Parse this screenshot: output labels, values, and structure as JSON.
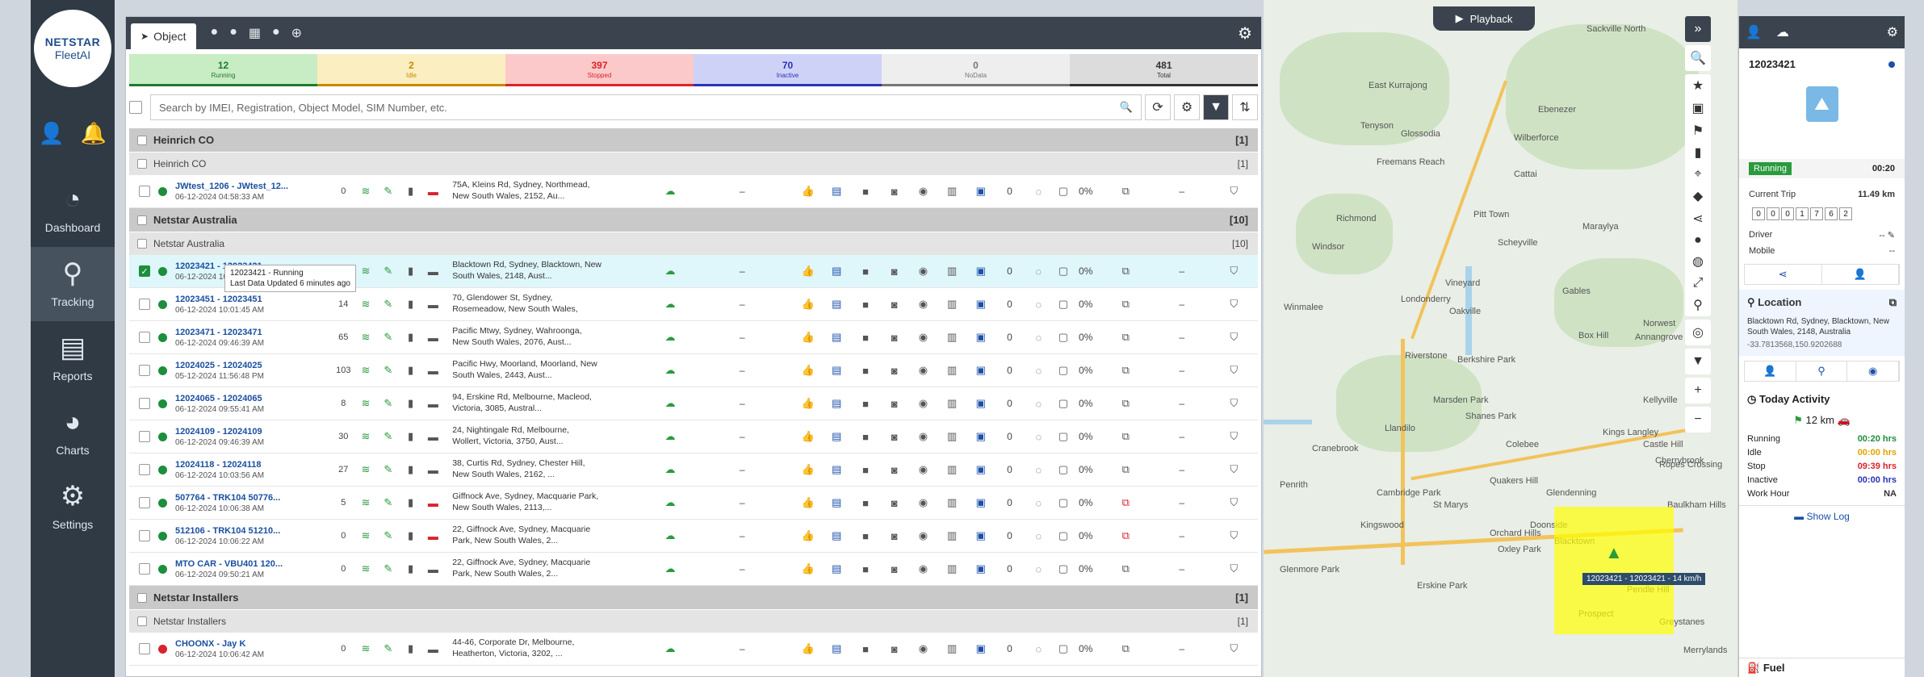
{
  "brand": {
    "line1": "NETSTAR",
    "line2": "FleetAI"
  },
  "nav": {
    "user_icon": "user-icon",
    "bell_icon": "bell-icon",
    "items": [
      {
        "label": "Dashboard",
        "icon": "◔",
        "active": false
      },
      {
        "label": "Tracking",
        "icon": "⚲",
        "active": true
      },
      {
        "label": "Reports",
        "icon": "▤",
        "active": false
      },
      {
        "label": "Charts",
        "icon": "◕",
        "active": false
      },
      {
        "label": "Settings",
        "icon": "⚙",
        "active": false
      }
    ]
  },
  "panel": {
    "tab_label": "Object",
    "status": [
      {
        "count": "12",
        "label": "Running",
        "bg": "#c8ecc4",
        "color": "#1d7a30"
      },
      {
        "count": "2",
        "label": "Idle",
        "bg": "#fbeec0",
        "color": "#c98a00"
      },
      {
        "count": "397",
        "label": "Stopped",
        "bg": "#fbc9c9",
        "color": "#d9232d"
      },
      {
        "count": "70",
        "label": "Inactive",
        "bg": "#cfd2f7",
        "color": "#2832b8"
      },
      {
        "count": "0",
        "label": "NoData",
        "bg": "#eeeeee",
        "color": "#777777"
      },
      {
        "count": "481",
        "label": "Total",
        "bg": "#dcdcdc",
        "color": "#333333"
      }
    ],
    "search_placeholder": "Search by IMEI, Registration, Object Model, SIM Number, etc.",
    "groups": [
      {
        "name": "Heinrich CO",
        "count": "[1]",
        "sub": "Heinrich CO",
        "subcount": "[1]"
      },
      {
        "name": "Netstar Australia",
        "count": "[10]",
        "sub": "Netstar Australia",
        "subcount": "[10]"
      },
      {
        "name": "Netstar Installers",
        "count": "[1]",
        "sub": "Netstar Installers",
        "subcount": "[1]"
      }
    ],
    "rows": [
      {
        "id": "JWtest_1206 - JWtest_12...",
        "ts": "06-12-2024 04:58:33 AM",
        "speed": "0",
        "addr1": "75A, Kleins Rd, Sydney, Northmead,",
        "addr2": "New South Wales, 2152, Au...",
        "dot": "#1d8e3c",
        "dash": "–",
        "zero": "0",
        "pct": "0%",
        "checked": false,
        "sel": false
      },
      {
        "id": "12023421 - 12023421",
        "ts": "06-12-2024 10:02:45 AM",
        "speed": "14",
        "addr1": "Blacktown Rd, Sydney, Blacktown, New",
        "addr2": "South Wales, 2148, Aust...",
        "dot": "#1d8e3c",
        "dash": "–",
        "zero": "0",
        "pct": "0%",
        "checked": true,
        "sel": true
      },
      {
        "id": "12023451 - 12023451",
        "ts": "06-12-2024 10:01:45 AM",
        "speed": "14",
        "addr1": "70, Glendower St, Sydney,",
        "addr2": "Rosemeadow, New South Wales,",
        "dot": "#1d8e3c",
        "dash": "–",
        "zero": "0",
        "pct": "0%",
        "checked": false,
        "sel": false
      },
      {
        "id": "12023471 - 12023471",
        "ts": "06-12-2024 09:46:39 AM",
        "speed": "65",
        "addr1": "Pacific Mtwy, Sydney, Wahroonga,",
        "addr2": "New South Wales, 2076, Aust...",
        "dot": "#1d8e3c",
        "dash": "–",
        "zero": "0",
        "pct": "0%",
        "checked": false,
        "sel": false
      },
      {
        "id": "12024025 - 12024025",
        "ts": "05-12-2024 11:56:48 PM",
        "speed": "103",
        "addr1": "Pacific Hwy, Moorland, Moorland, New",
        "addr2": "South Wales, 2443, Aust...",
        "dot": "#1d8e3c",
        "dash": "–",
        "zero": "0",
        "pct": "0%",
        "checked": false,
        "sel": false
      },
      {
        "id": "12024065 - 12024065",
        "ts": "06-12-2024 09:55:41 AM",
        "speed": "8",
        "addr1": "94, Erskine Rd, Melbourne, Macleod,",
        "addr2": "Victoria, 3085, Austral...",
        "dot": "#1d8e3c",
        "dash": "–",
        "zero": "0",
        "pct": "0%",
        "checked": false,
        "sel": false
      },
      {
        "id": "12024109 - 12024109",
        "ts": "06-12-2024 09:46:39 AM",
        "speed": "30",
        "addr1": "24, Nightingale Rd, Melbourne,",
        "addr2": "Wollert, Victoria, 3750, Aust...",
        "dot": "#1d8e3c",
        "dash": "–",
        "zero": "0",
        "pct": "0%",
        "checked": false,
        "sel": false
      },
      {
        "id": "12024118 - 12024118",
        "ts": "06-12-2024 10:03:56 AM",
        "speed": "27",
        "addr1": "38, Curtis Rd, Sydney, Chester Hill,",
        "addr2": "New South Wales, 2162, ...",
        "dot": "#1d8e3c",
        "dash": "–",
        "zero": "0",
        "pct": "0%",
        "checked": false,
        "sel": false
      },
      {
        "id": "507764 - TRK104 50776...",
        "ts": "06-12-2024 10:06:38 AM",
        "speed": "5",
        "addr1": "Giffnock Ave, Sydney, Macquarie Park,",
        "addr2": "New South Wales, 2113,...",
        "dot": "#1d8e3c",
        "dash": "–",
        "zero": "0",
        "pct": "0%",
        "checked": false,
        "sel": false
      },
      {
        "id": "512106 - TRK104 51210...",
        "ts": "06-12-2024 10:06:22 AM",
        "speed": "0",
        "addr1": "22, Giffnock Ave, Sydney, Macquarie",
        "addr2": "Park, New South Wales, 2...",
        "dot": "#1d8e3c",
        "dash": "–",
        "zero": "0",
        "pct": "0%",
        "checked": false,
        "sel": false
      },
      {
        "id": "MTO CAR - VBU401 120...",
        "ts": "06-12-2024 09:50:21 AM",
        "speed": "0",
        "addr1": "22, Giffnock Ave, Sydney, Macquarie",
        "addr2": "Park, New South Wales, 2...",
        "dot": "#1d8e3c",
        "dash": "–",
        "zero": "0",
        "pct": "0%",
        "checked": false,
        "sel": false
      },
      {
        "id": "CHOONX - Jay K",
        "ts": "06-12-2024 10:06:42 AM",
        "speed": "0",
        "addr1": "44-46, Corporate Dr, Melbourne,",
        "addr2": "Heatherton, Victoria, 3202, ...",
        "dot": "#d9232d",
        "dash": "–",
        "zero": "0",
        "pct": "0%",
        "checked": false,
        "sel": false
      }
    ],
    "tooltip_line1": "12023421 - Running",
    "tooltip_line2": "Last Data Updated 6 minutes ago"
  },
  "map": {
    "playback_label": "Playback",
    "vehicle_label": "12023421 - 12023421 - 14 km/h",
    "places": [
      {
        "t": "Sackville North"
      },
      {
        "t": "Ebenezer"
      },
      {
        "t": "East Kurrajong"
      },
      {
        "t": "Glossodia"
      },
      {
        "t": "Wilberforce"
      },
      {
        "t": "Freemans Reach"
      },
      {
        "t": "Cattai"
      },
      {
        "t": "Richmond"
      },
      {
        "t": "Pitt Town"
      },
      {
        "t": "Maraylya"
      },
      {
        "t": "Windsor"
      },
      {
        "t": "Scheyville"
      },
      {
        "t": "Londonderry"
      },
      {
        "t": "Marsden Park"
      },
      {
        "t": "Riverstone"
      },
      {
        "t": "Box Hill"
      },
      {
        "t": "Annangrove"
      },
      {
        "t": "Penrith"
      },
      {
        "t": "St Marys"
      },
      {
        "t": "Blacktown"
      },
      {
        "t": "Kellyville"
      },
      {
        "t": "Glenmore Park"
      },
      {
        "t": "Erskine Park"
      },
      {
        "t": "Greystanes"
      },
      {
        "t": "Castle Hill"
      },
      {
        "t": "Baulkham Hills"
      },
      {
        "t": "Tenyson"
      },
      {
        "t": "Vineyard"
      },
      {
        "t": "Oakville"
      },
      {
        "t": "Gables"
      },
      {
        "t": "Shanes Park"
      },
      {
        "t": "Llandilo"
      },
      {
        "t": "Berkshire Park"
      },
      {
        "t": "Colebee"
      },
      {
        "t": "Quakers Hill"
      },
      {
        "t": "Kings Langley"
      },
      {
        "t": "Cranebrook"
      },
      {
        "t": "Cambridge Park"
      },
      {
        "t": "Kingswood"
      },
      {
        "t": "Orchard Hills"
      },
      {
        "t": "Oxley Park"
      },
      {
        "t": "Doonside"
      },
      {
        "t": "Prospect"
      },
      {
        "t": "Pendle Hill"
      },
      {
        "t": "Glendenning"
      },
      {
        "t": "Ropes Crossing"
      },
      {
        "t": "Norwest"
      },
      {
        "t": "Winmalee"
      },
      {
        "t": "Cherrybrook"
      },
      {
        "t": "Merrylands"
      }
    ]
  },
  "info": {
    "id": "12023421",
    "status": "Running",
    "status_time": "00:20",
    "current_trip_label": "Current Trip",
    "current_trip_value": "11.49 km",
    "odometer": [
      "0",
      "0",
      "0",
      "1",
      "7",
      "6",
      "2"
    ],
    "driver_label": "Driver",
    "driver_value": "--",
    "mobile_label": "Mobile",
    "mobile_value": "--",
    "location_title": "Location",
    "location_addr": "Blacktown Rd, Sydney, Blacktown, New South Wales, 2148, Australia",
    "location_coord": "-33.7813568,150.9202688",
    "activity_title": "Today Activity",
    "activity_km": "12 km",
    "activity": [
      {
        "label": "Running",
        "value": "00:20 hrs",
        "color": "#1d8e3c"
      },
      {
        "label": "Idle",
        "value": "00:00 hrs",
        "color": "#e0a300"
      },
      {
        "label": "Stop",
        "value": "09:39 hrs",
        "color": "#d9232d"
      },
      {
        "label": "Inactive",
        "value": "00:00 hrs",
        "color": "#2832b8"
      },
      {
        "label": "Work Hour",
        "value": "NA",
        "color": "#333333"
      }
    ],
    "show_log": "Show Log",
    "fuel_label": "Fuel"
  }
}
